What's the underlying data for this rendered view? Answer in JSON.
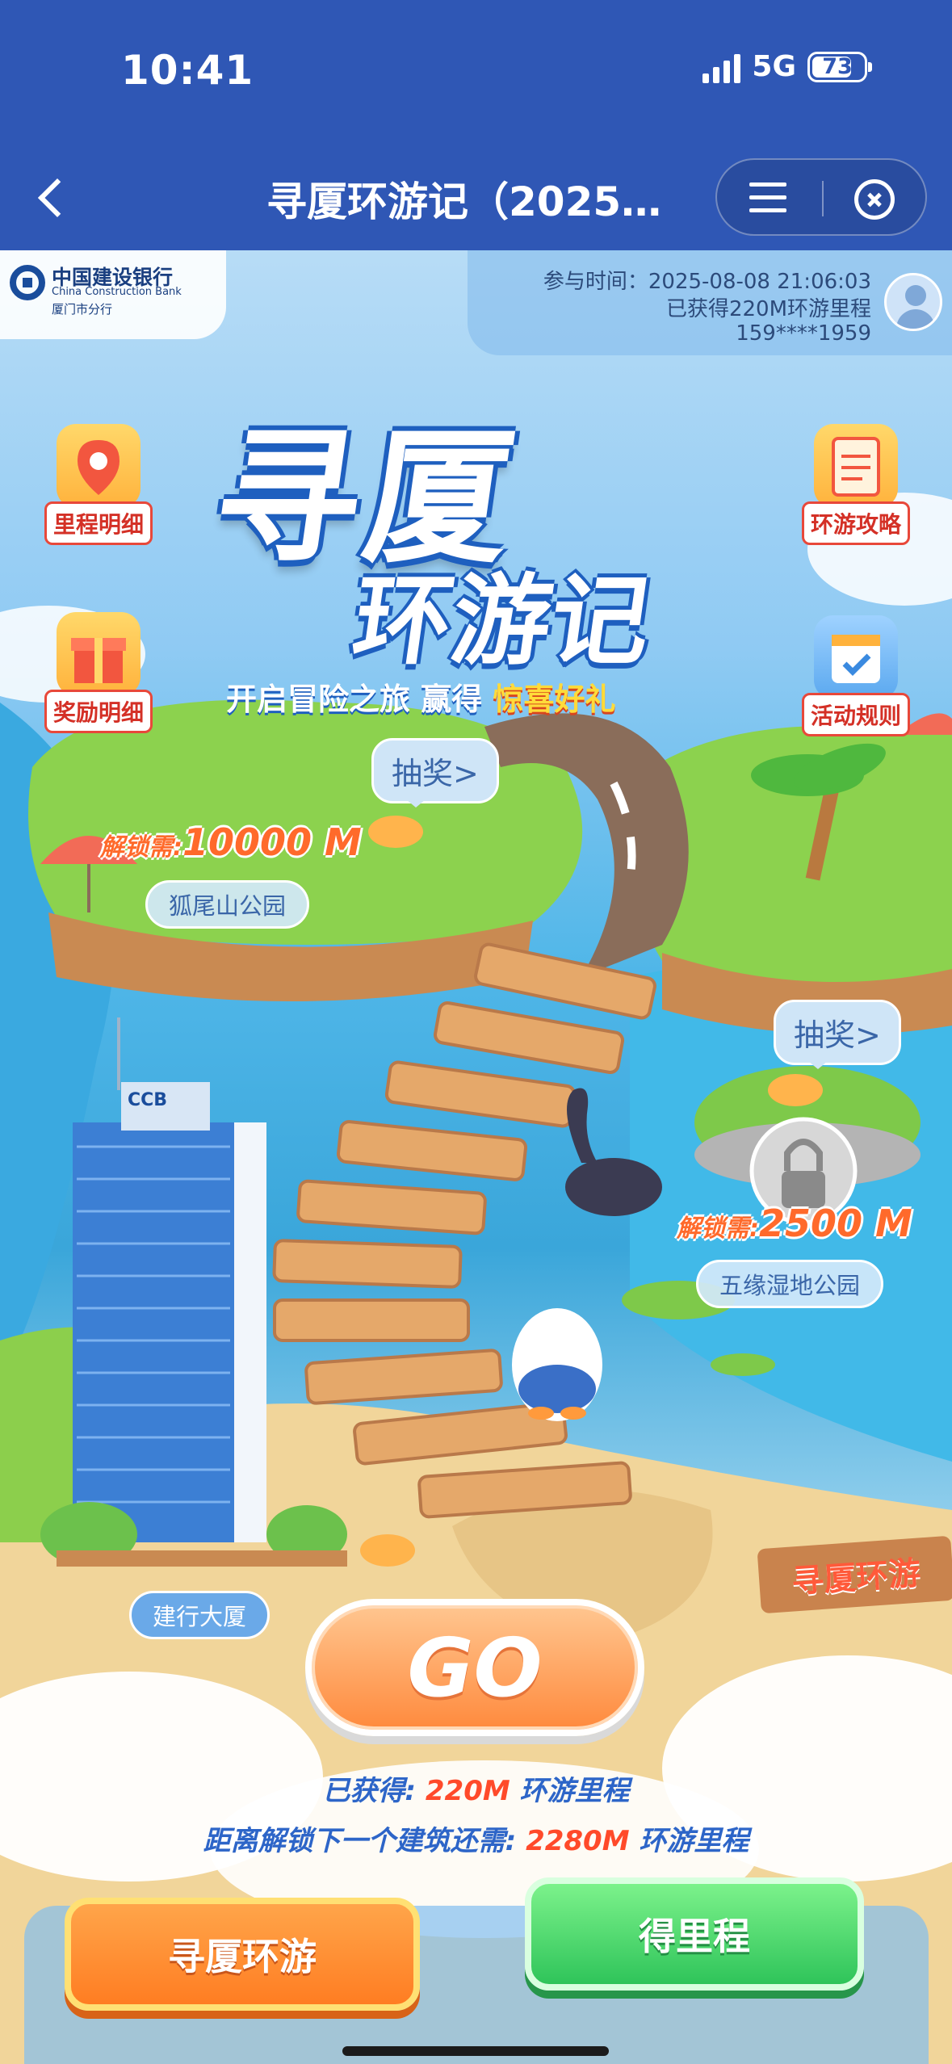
{
  "status_bar": {
    "time": "10:41",
    "network": "5G",
    "battery": "73"
  },
  "nav": {
    "title": "寻厦环游记（2025…"
  },
  "bank": {
    "name_cn": "中国建设银行",
    "name_en": "China Construction Bank",
    "branch": "厦门市分行"
  },
  "user": {
    "join_time_label": "参与时间：2025-08-08 21:06:03",
    "earned_label": "已获得220M环游里程",
    "phone": "159****1959"
  },
  "hero": {
    "title_line1": "寻厦",
    "title_line2": "环游记",
    "slogan_a": "开启冒险之旅 赢得",
    "slogan_b": "惊喜好礼"
  },
  "side_buttons": {
    "mileage_detail": "里程明细",
    "reward_detail": "奖励明细",
    "travel_guide": "环游攻略",
    "activity_rules": "活动规则"
  },
  "map": {
    "lottery_label": "抽奖>",
    "location_1": {
      "name": "狐尾山公园",
      "unlock_prefix": "解锁需:",
      "unlock_value": "10000 M"
    },
    "location_2": {
      "name": "五缘湿地公园",
      "unlock_prefix": "解锁需:",
      "unlock_value": "2500 M"
    },
    "location_3": {
      "name": "建行大厦"
    },
    "building_sign": "CCB",
    "signpost": "寻厦环游"
  },
  "go_label": "GO",
  "progress": {
    "earned_prefix": "已获得:",
    "earned_value": "220M",
    "earned_suffix": "环游里程",
    "remain_prefix": "距离解锁下一个建筑还需:",
    "remain_value": "2280M",
    "remain_suffix": "环游里程"
  },
  "tabs": {
    "tour": "寻厦环游",
    "earn": "得里程"
  },
  "colors": {
    "nav_bg": "#2f57b5",
    "accent_red": "#ff4a2a",
    "accent_blue": "#2d65c8",
    "go_orange": "#ff8a3d",
    "green_button": "#2fc45a"
  }
}
